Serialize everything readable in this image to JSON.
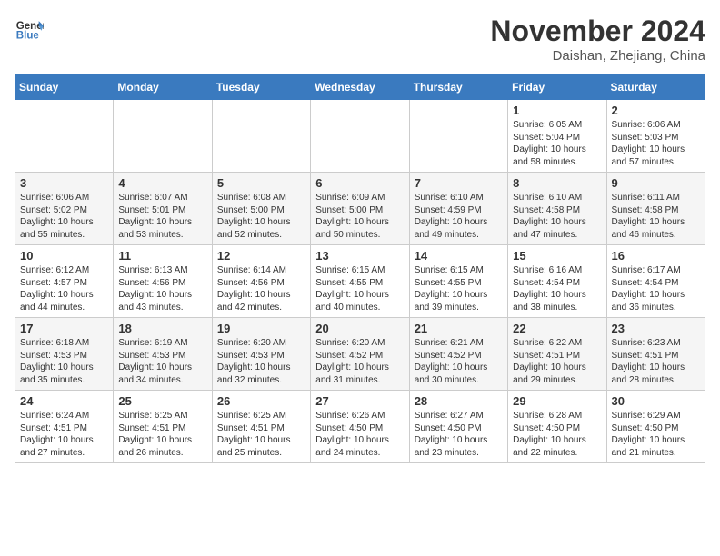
{
  "header": {
    "logo_line1": "General",
    "logo_line2": "Blue",
    "month": "November 2024",
    "location": "Daishan, Zhejiang, China"
  },
  "weekdays": [
    "Sunday",
    "Monday",
    "Tuesday",
    "Wednesday",
    "Thursday",
    "Friday",
    "Saturday"
  ],
  "weeks": [
    [
      {
        "day": "",
        "text": ""
      },
      {
        "day": "",
        "text": ""
      },
      {
        "day": "",
        "text": ""
      },
      {
        "day": "",
        "text": ""
      },
      {
        "day": "",
        "text": ""
      },
      {
        "day": "1",
        "text": "Sunrise: 6:05 AM\nSunset: 5:04 PM\nDaylight: 10 hours and 58 minutes."
      },
      {
        "day": "2",
        "text": "Sunrise: 6:06 AM\nSunset: 5:03 PM\nDaylight: 10 hours and 57 minutes."
      }
    ],
    [
      {
        "day": "3",
        "text": "Sunrise: 6:06 AM\nSunset: 5:02 PM\nDaylight: 10 hours and 55 minutes."
      },
      {
        "day": "4",
        "text": "Sunrise: 6:07 AM\nSunset: 5:01 PM\nDaylight: 10 hours and 53 minutes."
      },
      {
        "day": "5",
        "text": "Sunrise: 6:08 AM\nSunset: 5:00 PM\nDaylight: 10 hours and 52 minutes."
      },
      {
        "day": "6",
        "text": "Sunrise: 6:09 AM\nSunset: 5:00 PM\nDaylight: 10 hours and 50 minutes."
      },
      {
        "day": "7",
        "text": "Sunrise: 6:10 AM\nSunset: 4:59 PM\nDaylight: 10 hours and 49 minutes."
      },
      {
        "day": "8",
        "text": "Sunrise: 6:10 AM\nSunset: 4:58 PM\nDaylight: 10 hours and 47 minutes."
      },
      {
        "day": "9",
        "text": "Sunrise: 6:11 AM\nSunset: 4:58 PM\nDaylight: 10 hours and 46 minutes."
      }
    ],
    [
      {
        "day": "10",
        "text": "Sunrise: 6:12 AM\nSunset: 4:57 PM\nDaylight: 10 hours and 44 minutes."
      },
      {
        "day": "11",
        "text": "Sunrise: 6:13 AM\nSunset: 4:56 PM\nDaylight: 10 hours and 43 minutes."
      },
      {
        "day": "12",
        "text": "Sunrise: 6:14 AM\nSunset: 4:56 PM\nDaylight: 10 hours and 42 minutes."
      },
      {
        "day": "13",
        "text": "Sunrise: 6:15 AM\nSunset: 4:55 PM\nDaylight: 10 hours and 40 minutes."
      },
      {
        "day": "14",
        "text": "Sunrise: 6:15 AM\nSunset: 4:55 PM\nDaylight: 10 hours and 39 minutes."
      },
      {
        "day": "15",
        "text": "Sunrise: 6:16 AM\nSunset: 4:54 PM\nDaylight: 10 hours and 38 minutes."
      },
      {
        "day": "16",
        "text": "Sunrise: 6:17 AM\nSunset: 4:54 PM\nDaylight: 10 hours and 36 minutes."
      }
    ],
    [
      {
        "day": "17",
        "text": "Sunrise: 6:18 AM\nSunset: 4:53 PM\nDaylight: 10 hours and 35 minutes."
      },
      {
        "day": "18",
        "text": "Sunrise: 6:19 AM\nSunset: 4:53 PM\nDaylight: 10 hours and 34 minutes."
      },
      {
        "day": "19",
        "text": "Sunrise: 6:20 AM\nSunset: 4:53 PM\nDaylight: 10 hours and 32 minutes."
      },
      {
        "day": "20",
        "text": "Sunrise: 6:20 AM\nSunset: 4:52 PM\nDaylight: 10 hours and 31 minutes."
      },
      {
        "day": "21",
        "text": "Sunrise: 6:21 AM\nSunset: 4:52 PM\nDaylight: 10 hours and 30 minutes."
      },
      {
        "day": "22",
        "text": "Sunrise: 6:22 AM\nSunset: 4:51 PM\nDaylight: 10 hours and 29 minutes."
      },
      {
        "day": "23",
        "text": "Sunrise: 6:23 AM\nSunset: 4:51 PM\nDaylight: 10 hours and 28 minutes."
      }
    ],
    [
      {
        "day": "24",
        "text": "Sunrise: 6:24 AM\nSunset: 4:51 PM\nDaylight: 10 hours and 27 minutes."
      },
      {
        "day": "25",
        "text": "Sunrise: 6:25 AM\nSunset: 4:51 PM\nDaylight: 10 hours and 26 minutes."
      },
      {
        "day": "26",
        "text": "Sunrise: 6:25 AM\nSunset: 4:51 PM\nDaylight: 10 hours and 25 minutes."
      },
      {
        "day": "27",
        "text": "Sunrise: 6:26 AM\nSunset: 4:50 PM\nDaylight: 10 hours and 24 minutes."
      },
      {
        "day": "28",
        "text": "Sunrise: 6:27 AM\nSunset: 4:50 PM\nDaylight: 10 hours and 23 minutes."
      },
      {
        "day": "29",
        "text": "Sunrise: 6:28 AM\nSunset: 4:50 PM\nDaylight: 10 hours and 22 minutes."
      },
      {
        "day": "30",
        "text": "Sunrise: 6:29 AM\nSunset: 4:50 PM\nDaylight: 10 hours and 21 minutes."
      }
    ]
  ]
}
